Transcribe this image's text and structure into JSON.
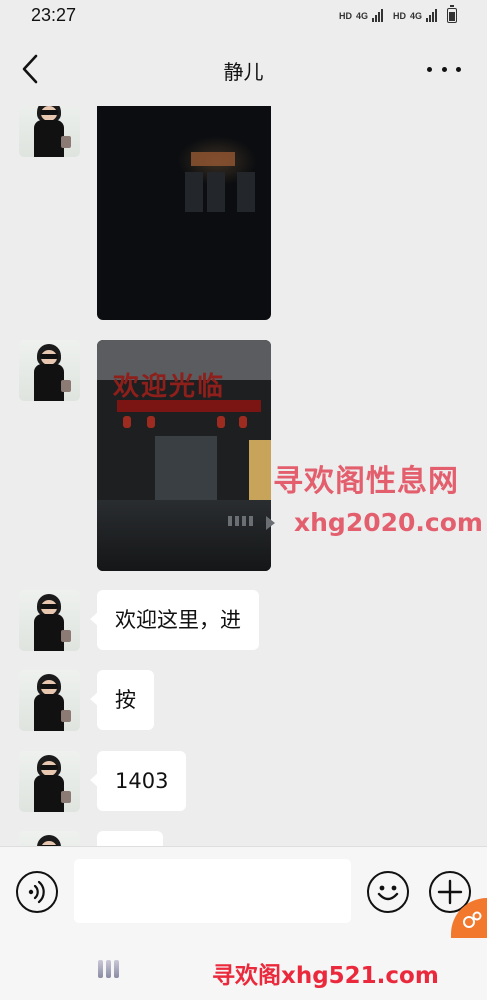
{
  "status_bar": {
    "time": "23:27",
    "network_1": "HD",
    "network_1_type": "4G",
    "network_2": "HD",
    "network_2_type": "4G",
    "battery_icon": "battery-icon"
  },
  "header": {
    "title": "静儿",
    "back_icon": "back-arrow-icon",
    "more_icon": "more-icon"
  },
  "photo_2": {
    "sign_text": "欢迎光临"
  },
  "messages": [
    {
      "type": "image",
      "sender": "contact"
    },
    {
      "type": "image",
      "sender": "contact"
    },
    {
      "type": "text",
      "sender": "contact",
      "text": "欢迎这里，进"
    },
    {
      "type": "text",
      "sender": "contact",
      "text": "按"
    },
    {
      "type": "text",
      "sender": "contact",
      "text": "1403"
    },
    {
      "type": "text",
      "sender": "contact",
      "text": ""
    }
  ],
  "watermarks": {
    "site_name": "寻欢阁性息网",
    "site_url": "xhg2020.com",
    "bottom": "寻欢阁xhg521.com"
  },
  "input_bar": {
    "value": "",
    "voice_icon": "voice-icon",
    "emoji_icon": "emoji-icon",
    "plus_icon": "plus-icon"
  },
  "colors": {
    "background": "#ededed",
    "bubble": "#ffffff",
    "watermark": "#e35f6e",
    "bottom_watermark": "#ea2a3c"
  }
}
